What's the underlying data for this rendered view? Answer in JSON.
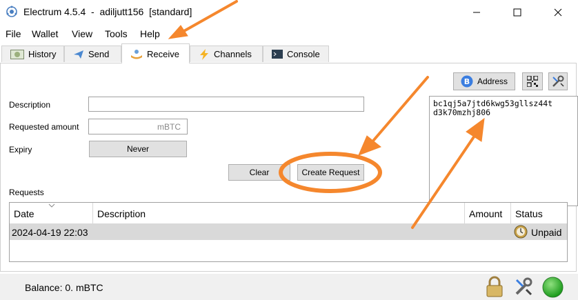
{
  "window": {
    "title": "Electrum 4.5.4  -  adiljutt156  [standard]"
  },
  "menu": [
    "File",
    "Wallet",
    "View",
    "Tools",
    "Help"
  ],
  "tabs": [
    "History",
    "Send",
    "Receive",
    "Channels",
    "Console"
  ],
  "active_tab": "Receive",
  "receive": {
    "description_label": "Description",
    "description_value": "",
    "amount_label": "Requested amount",
    "amount_unit": "mBTC",
    "expiry_label": "Expiry",
    "expiry_value": "Never",
    "clear_label": "Clear",
    "create_label": "Create Request",
    "address_toggle_label": "Address",
    "address_text": "bc1qj5a7jtd6kwg53gllsz44t\nd3k70mzhj806"
  },
  "requests": {
    "title": "Requests",
    "columns": [
      "Date",
      "Description",
      "Amount",
      "Status"
    ],
    "rows": [
      {
        "date": "2024-04-19 22:03",
        "description": "",
        "amount": "",
        "status": "Unpaid"
      }
    ]
  },
  "statusbar": {
    "balance": "Balance: 0. mBTC"
  },
  "colors": {
    "annotation": "#f5872d",
    "status_ok": "#1fa51f",
    "tab_bg": "#f0f0f0",
    "selected_row": "#d9d9d9"
  }
}
